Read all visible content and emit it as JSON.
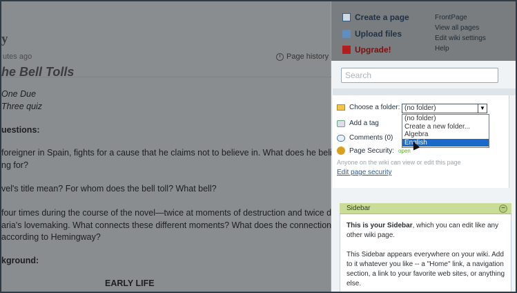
{
  "page": {
    "title_fragment": "y",
    "subtitle": "utes ago",
    "page_history": "Page history",
    "book_title": "he Bell Tolls",
    "due": "One Due",
    "quiz": "Three quiz",
    "questions_heading": "uestions:",
    "q1a": "foreigner in Spain, fights for a cause that he claims not to believe in. What does he believe",
    "q1b": "ng for?",
    "q2": "vel's title mean? For whom does the bell toll? What bell?",
    "q3a": "four times during the course of the novel—twice at moments of destruction and twice during",
    "q3b": "aria's lovemaking. What connects these different moments? What does the connection say",
    "q3c": "according to Hemingway?",
    "background_heading": "kground:",
    "early_life": "EARLY LIFE"
  },
  "actions": {
    "create_page": "Create a page",
    "upload_files": "Upload files",
    "upgrade": "Upgrade!"
  },
  "links": [
    "FrontPage",
    "View all pages",
    "Edit wiki settings",
    "Help"
  ],
  "search": {
    "placeholder": "Search"
  },
  "folder": {
    "label": "Choose a folder:",
    "selected": "(no folder)",
    "options": [
      "(no folder)",
      "Create a new folder...",
      "Algebra",
      "English"
    ],
    "highlighted": "English"
  },
  "panel": {
    "add_tag": "Add a tag",
    "comments": "Comments (0)",
    "page_security": "Page Security:",
    "security_value": "open",
    "anyone": "Anyone on the wiki can view or edit this page",
    "edit_security": "Edit page security"
  },
  "sidebar": {
    "header": "Sidebar",
    "intro_bold": "This is your Sidebar",
    "intro_rest": ", which you can edit like any other wiki page.",
    "body": "This Sidebar appears everywhere on your wiki. Add to it whatever you like -- a \"Home\" link, a navigation section, a link to your favorite web sites, or anything else."
  },
  "colors": {
    "highlight": "#1b6ac9",
    "upgrade": "#7a1010",
    "sidebar_header": "#c9dd98"
  }
}
